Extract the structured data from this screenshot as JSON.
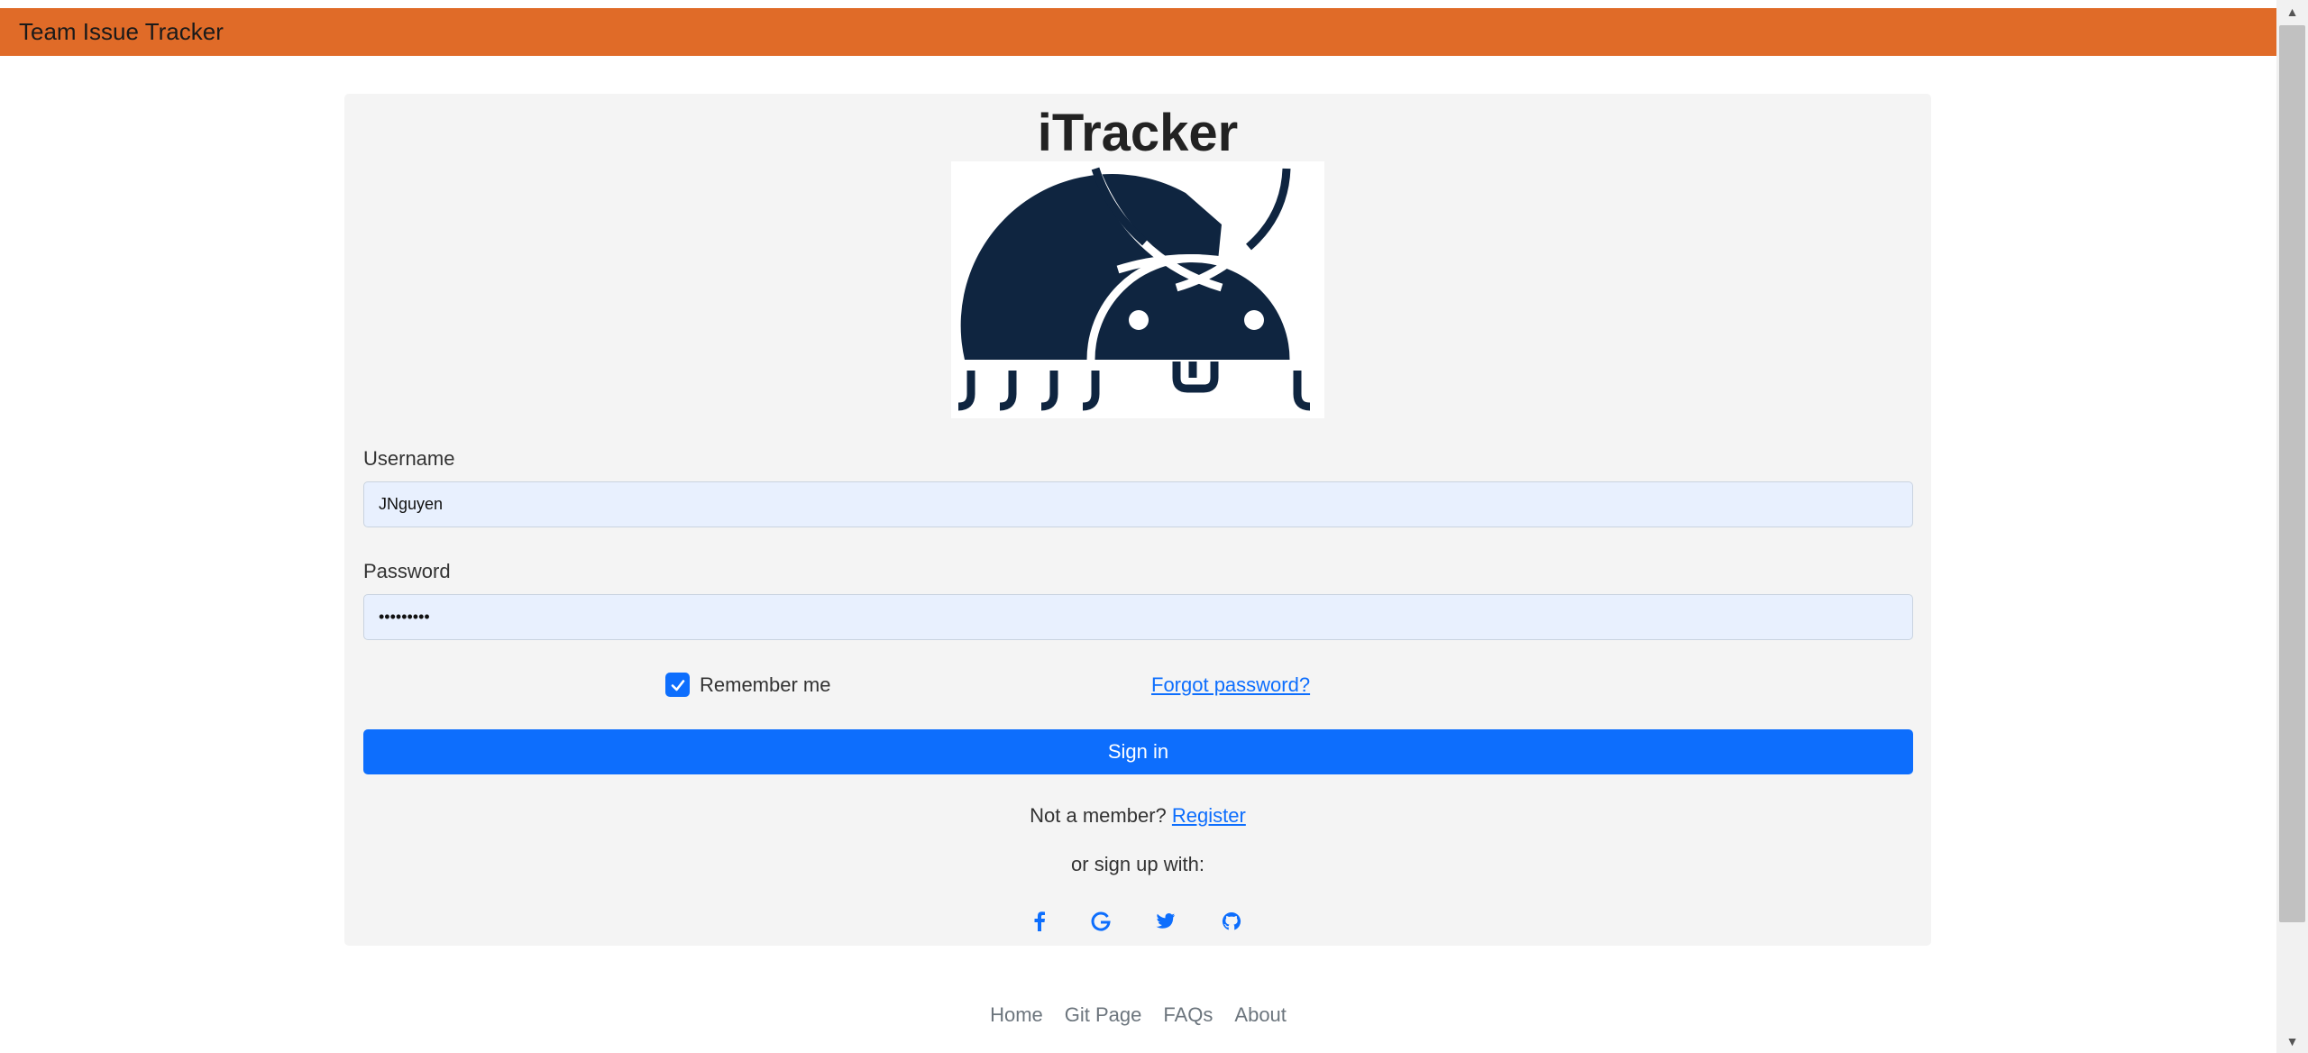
{
  "navbar": {
    "brand": "Team Issue Tracker"
  },
  "login": {
    "title": "iTracker",
    "username_label": "Username",
    "username_value": "JNguyen",
    "password_label": "Password",
    "password_value": "•••••••••",
    "remember_label": "Remember me",
    "remember_checked": true,
    "forgot_label": "Forgot password?",
    "signin_label": "Sign in",
    "not_member_text": "Not a member?",
    "register_label": "Register",
    "signup_with_text": "or sign up with:"
  },
  "social": [
    {
      "icon": "facebook-icon"
    },
    {
      "icon": "google-icon"
    },
    {
      "icon": "twitter-icon"
    },
    {
      "icon": "github-icon"
    }
  ],
  "footer": {
    "links": [
      "Home",
      "Git Page",
      "FAQs",
      "About"
    ]
  },
  "colors": {
    "navbar": "#e06b28",
    "primary": "#0d6efd",
    "card": "#f4f4f4",
    "input_bg": "#e8f0fe",
    "logo": "#0f2540"
  }
}
